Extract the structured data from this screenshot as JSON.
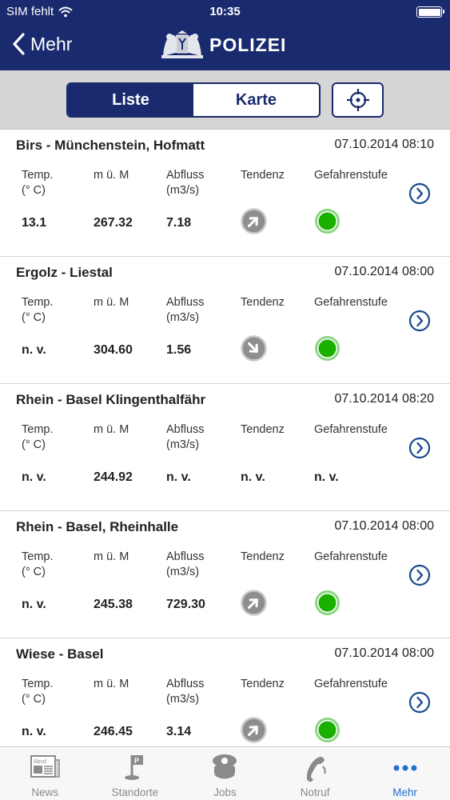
{
  "status": {
    "carrier": "SIM fehlt",
    "time": "10:35"
  },
  "nav": {
    "back_label": "Mehr",
    "title": "POLIZEI"
  },
  "segmented": {
    "list_label": "Liste",
    "map_label": "Karte",
    "selected": "Liste"
  },
  "labels": {
    "temp_line1": "Temp.",
    "temp_line2": "(° C)",
    "height": "m ü. M",
    "flow_line1": "Abfluss",
    "flow_line2": "(m3/s)",
    "trend": "Tendenz",
    "danger": "Gefahrenstufe"
  },
  "stations": [
    {
      "name": "Birs - Münchenstein, Hofmatt",
      "datetime": "07.10.2014 08:10",
      "temp": "13.1",
      "height": "267.32",
      "flow": "7.18",
      "trend": "up",
      "danger": "green",
      "trend_text": "",
      "danger_text": ""
    },
    {
      "name": "Ergolz - Liestal",
      "datetime": "07.10.2014 08:00",
      "temp": "n. v.",
      "height": "304.60",
      "flow": "1.56",
      "trend": "down",
      "danger": "green",
      "trend_text": "",
      "danger_text": ""
    },
    {
      "name": "Rhein - Basel Klingenthalfähr",
      "datetime": "07.10.2014 08:20",
      "temp": "n. v.",
      "height": "244.92",
      "flow": "n. v.",
      "trend": "none",
      "danger": "none",
      "trend_text": "n. v.",
      "danger_text": "n. v."
    },
    {
      "name": "Rhein - Basel, Rheinhalle",
      "datetime": "07.10.2014 08:00",
      "temp": "n. v.",
      "height": "245.38",
      "flow": "729.30",
      "trend": "up",
      "danger": "green",
      "trend_text": "",
      "danger_text": ""
    },
    {
      "name": "Wiese - Basel",
      "datetime": "07.10.2014 08:00",
      "temp": "n. v.",
      "height": "246.45",
      "flow": "3.14",
      "trend": "up",
      "danger": "green",
      "trend_text": "",
      "danger_text": ""
    }
  ],
  "tabs": [
    {
      "label": "News",
      "icon": "newspaper-icon"
    },
    {
      "label": "Standorte",
      "icon": "location-flag-icon"
    },
    {
      "label": "Jobs",
      "icon": "police-cap-icon"
    },
    {
      "label": "Notruf",
      "icon": "phone-icon"
    },
    {
      "label": "Mehr",
      "icon": "more-dots-icon",
      "active": true
    }
  ],
  "colors": {
    "navy": "#1a2a6e",
    "danger_green": "#19b000",
    "tab_active": "#1f6fd0",
    "tab_inactive": "#8a8a8a"
  }
}
